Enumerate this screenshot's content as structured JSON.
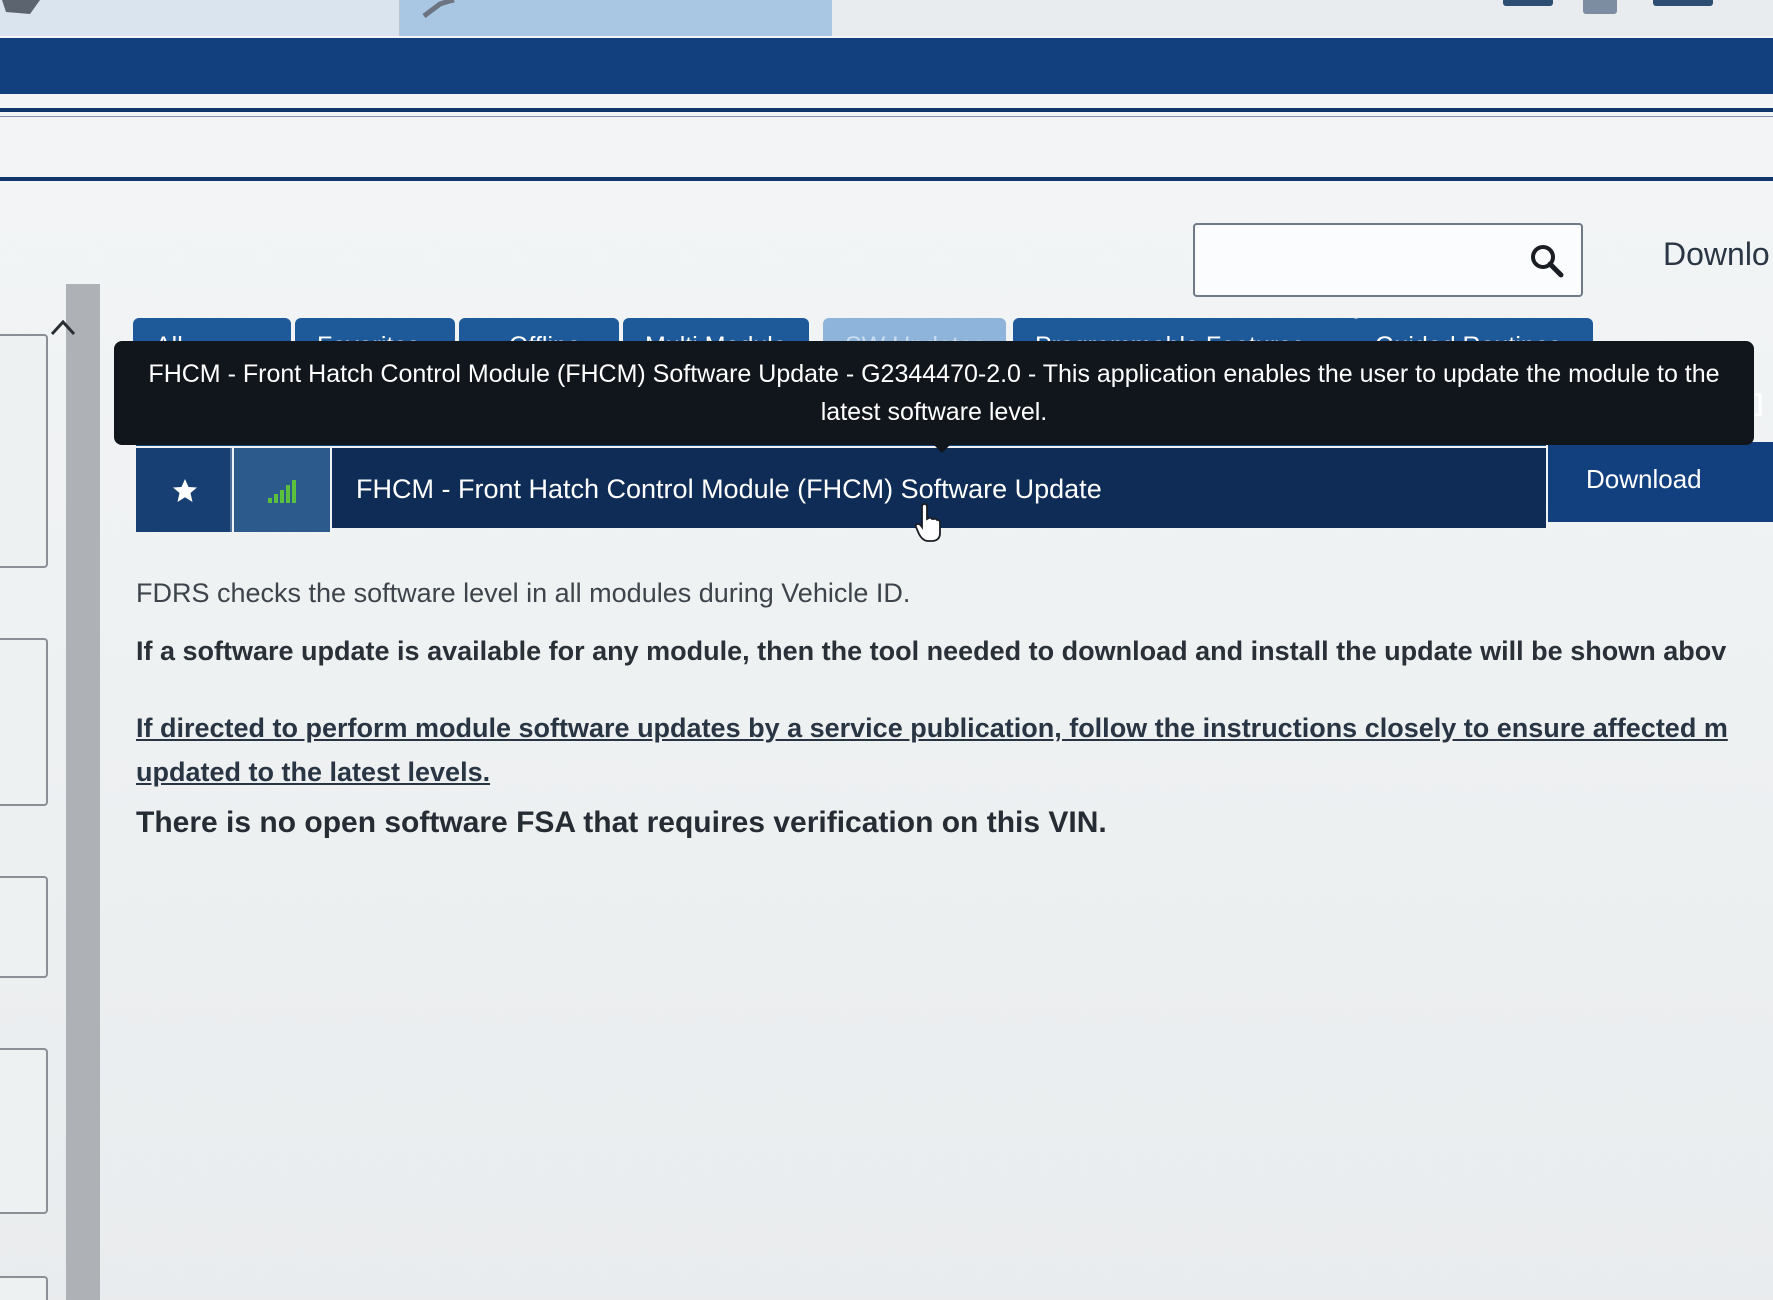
{
  "search": {
    "value": "",
    "placeholder": ""
  },
  "header": {
    "download_label": "Downlo"
  },
  "tabs": [
    {
      "label": "All",
      "disabled": false
    },
    {
      "label": "Favorites",
      "disabled": false
    },
    {
      "label": "Offline",
      "disabled": false
    },
    {
      "label": "Multi Module",
      "disabled": false
    },
    {
      "label": "SW Updates",
      "disabled": true
    },
    {
      "label": "Programmable Features",
      "disabled": false
    },
    {
      "label": "Guided Routines",
      "disabled": false
    }
  ],
  "tooltip": {
    "text": "FHCM - Front Hatch Control Module (FHCM) Software Update - G2344470-2.0 - This application enables the user to update the module to the latest software level."
  },
  "row": {
    "name": "FHCM - Front Hatch Control Module (FHCM) Software Update",
    "action": "Download",
    "icons": {
      "favorite": "star-icon",
      "signal": "signal-icon"
    },
    "signal_color": "#5cc13a"
  },
  "info": {
    "line1": "FDRS checks the software level in all modules during Vehicle ID.",
    "line2": "If a software update is available for any module, then the tool needed to download and install the update will be shown abov",
    "line3": "If directed to perform module software updates by a service publication, follow the instructions closely to ensure affected m updated to the latest levels.",
    "line4": "There is no open software FSA that requires verification on this VIN."
  },
  "colors": {
    "header": "#12407e",
    "tab": "#1e5a9a",
    "tab_disabled": "#8eb4dc",
    "row_selected": "#0e2c55",
    "tooltip_bg": "#11161d"
  }
}
